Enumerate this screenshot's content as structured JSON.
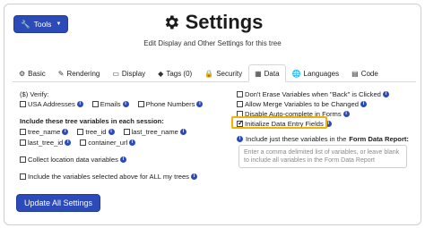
{
  "header": {
    "tools_label": "Tools",
    "title": "Settings",
    "subtitle": "Edit Display and Other Settings for this tree"
  },
  "tabs": [
    {
      "label": "Basic",
      "icon": "tag-icon",
      "active": false
    },
    {
      "label": "Rendering",
      "icon": "brush-icon",
      "active": false
    },
    {
      "label": "Display",
      "icon": "monitor-icon",
      "active": false
    },
    {
      "label": "Tags (0)",
      "icon": "tag-icon",
      "active": false
    },
    {
      "label": "Security",
      "icon": "lock-icon",
      "active": false
    },
    {
      "label": "Data",
      "icon": "table-icon",
      "active": true
    },
    {
      "label": "Languages",
      "icon": "globe-icon",
      "active": false
    },
    {
      "label": "Code",
      "icon": "code-icon",
      "active": false
    }
  ],
  "left": {
    "verify_heading": "($) Verify:",
    "verify": [
      "USA Addresses",
      "Emails",
      "Phone Numbers"
    ],
    "include_heading": "Include these tree variables in each session:",
    "variables_row1": [
      "tree_name",
      "tree_id",
      "last_tree_name"
    ],
    "variables_row2": [
      "last_tree_id",
      "container_url"
    ],
    "collect_location": "Collect location data variables",
    "include_all": "Include the variables selected above for ALL my trees"
  },
  "right": {
    "options": [
      {
        "label": "Don't Erase Variables when \"Back\" is Clicked",
        "checked": false
      },
      {
        "label": "Allow Merge Variables to be Changed",
        "checked": false
      },
      {
        "label": "Disable Auto-complete in Forms",
        "checked": false
      },
      {
        "label": "Initialize Data Entry Fields",
        "checked": true
      }
    ],
    "include_vars_prefix": "Include just these variables in the",
    "include_vars_bold": "Form Data Report:",
    "textarea_placeholder": "Enter a comma delimited list of variables, or leave blank to include all variables in the Form Data Report"
  },
  "footer": {
    "update_label": "Update All Settings"
  },
  "colors": {
    "primary": "#2c4bb8",
    "highlight": "#f2b200"
  }
}
